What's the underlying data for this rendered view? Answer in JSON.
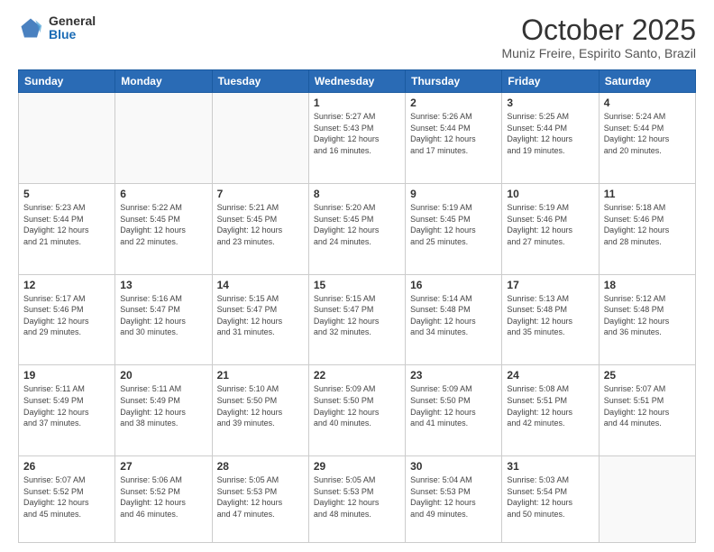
{
  "header": {
    "logo": {
      "line1": "General",
      "line2": "Blue"
    },
    "title": "October 2025",
    "subtitle": "Muniz Freire, Espirito Santo, Brazil"
  },
  "weekdays": [
    "Sunday",
    "Monday",
    "Tuesday",
    "Wednesday",
    "Thursday",
    "Friday",
    "Saturday"
  ],
  "weeks": [
    [
      {
        "day": "",
        "info": ""
      },
      {
        "day": "",
        "info": ""
      },
      {
        "day": "",
        "info": ""
      },
      {
        "day": "1",
        "info": "Sunrise: 5:27 AM\nSunset: 5:43 PM\nDaylight: 12 hours\nand 16 minutes."
      },
      {
        "day": "2",
        "info": "Sunrise: 5:26 AM\nSunset: 5:44 PM\nDaylight: 12 hours\nand 17 minutes."
      },
      {
        "day": "3",
        "info": "Sunrise: 5:25 AM\nSunset: 5:44 PM\nDaylight: 12 hours\nand 19 minutes."
      },
      {
        "day": "4",
        "info": "Sunrise: 5:24 AM\nSunset: 5:44 PM\nDaylight: 12 hours\nand 20 minutes."
      }
    ],
    [
      {
        "day": "5",
        "info": "Sunrise: 5:23 AM\nSunset: 5:44 PM\nDaylight: 12 hours\nand 21 minutes."
      },
      {
        "day": "6",
        "info": "Sunrise: 5:22 AM\nSunset: 5:45 PM\nDaylight: 12 hours\nand 22 minutes."
      },
      {
        "day": "7",
        "info": "Sunrise: 5:21 AM\nSunset: 5:45 PM\nDaylight: 12 hours\nand 23 minutes."
      },
      {
        "day": "8",
        "info": "Sunrise: 5:20 AM\nSunset: 5:45 PM\nDaylight: 12 hours\nand 24 minutes."
      },
      {
        "day": "9",
        "info": "Sunrise: 5:19 AM\nSunset: 5:45 PM\nDaylight: 12 hours\nand 25 minutes."
      },
      {
        "day": "10",
        "info": "Sunrise: 5:19 AM\nSunset: 5:46 PM\nDaylight: 12 hours\nand 27 minutes."
      },
      {
        "day": "11",
        "info": "Sunrise: 5:18 AM\nSunset: 5:46 PM\nDaylight: 12 hours\nand 28 minutes."
      }
    ],
    [
      {
        "day": "12",
        "info": "Sunrise: 5:17 AM\nSunset: 5:46 PM\nDaylight: 12 hours\nand 29 minutes."
      },
      {
        "day": "13",
        "info": "Sunrise: 5:16 AM\nSunset: 5:47 PM\nDaylight: 12 hours\nand 30 minutes."
      },
      {
        "day": "14",
        "info": "Sunrise: 5:15 AM\nSunset: 5:47 PM\nDaylight: 12 hours\nand 31 minutes."
      },
      {
        "day": "15",
        "info": "Sunrise: 5:15 AM\nSunset: 5:47 PM\nDaylight: 12 hours\nand 32 minutes."
      },
      {
        "day": "16",
        "info": "Sunrise: 5:14 AM\nSunset: 5:48 PM\nDaylight: 12 hours\nand 34 minutes."
      },
      {
        "day": "17",
        "info": "Sunrise: 5:13 AM\nSunset: 5:48 PM\nDaylight: 12 hours\nand 35 minutes."
      },
      {
        "day": "18",
        "info": "Sunrise: 5:12 AM\nSunset: 5:48 PM\nDaylight: 12 hours\nand 36 minutes."
      }
    ],
    [
      {
        "day": "19",
        "info": "Sunrise: 5:11 AM\nSunset: 5:49 PM\nDaylight: 12 hours\nand 37 minutes."
      },
      {
        "day": "20",
        "info": "Sunrise: 5:11 AM\nSunset: 5:49 PM\nDaylight: 12 hours\nand 38 minutes."
      },
      {
        "day": "21",
        "info": "Sunrise: 5:10 AM\nSunset: 5:50 PM\nDaylight: 12 hours\nand 39 minutes."
      },
      {
        "day": "22",
        "info": "Sunrise: 5:09 AM\nSunset: 5:50 PM\nDaylight: 12 hours\nand 40 minutes."
      },
      {
        "day": "23",
        "info": "Sunrise: 5:09 AM\nSunset: 5:50 PM\nDaylight: 12 hours\nand 41 minutes."
      },
      {
        "day": "24",
        "info": "Sunrise: 5:08 AM\nSunset: 5:51 PM\nDaylight: 12 hours\nand 42 minutes."
      },
      {
        "day": "25",
        "info": "Sunrise: 5:07 AM\nSunset: 5:51 PM\nDaylight: 12 hours\nand 44 minutes."
      }
    ],
    [
      {
        "day": "26",
        "info": "Sunrise: 5:07 AM\nSunset: 5:52 PM\nDaylight: 12 hours\nand 45 minutes."
      },
      {
        "day": "27",
        "info": "Sunrise: 5:06 AM\nSunset: 5:52 PM\nDaylight: 12 hours\nand 46 minutes."
      },
      {
        "day": "28",
        "info": "Sunrise: 5:05 AM\nSunset: 5:53 PM\nDaylight: 12 hours\nand 47 minutes."
      },
      {
        "day": "29",
        "info": "Sunrise: 5:05 AM\nSunset: 5:53 PM\nDaylight: 12 hours\nand 48 minutes."
      },
      {
        "day": "30",
        "info": "Sunrise: 5:04 AM\nSunset: 5:53 PM\nDaylight: 12 hours\nand 49 minutes."
      },
      {
        "day": "31",
        "info": "Sunrise: 5:03 AM\nSunset: 5:54 PM\nDaylight: 12 hours\nand 50 minutes."
      },
      {
        "day": "",
        "info": ""
      }
    ]
  ]
}
